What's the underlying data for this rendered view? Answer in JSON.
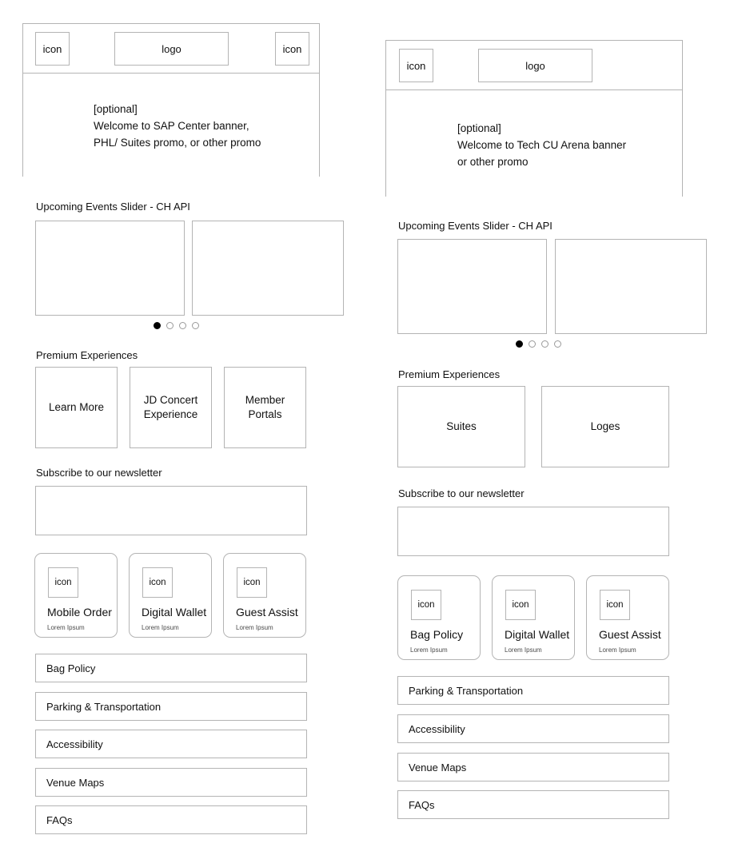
{
  "columns": [
    {
      "id": "sap-center",
      "header": {
        "left_icon": "icon",
        "logo": "logo",
        "right_icon": "icon",
        "banner_text": "[optional]\nWelcome to SAP Center banner,\nPHL/ Suites promo, or other promo"
      },
      "events": {
        "label": "Upcoming Events Slider - CH API",
        "slides": [
          "",
          ""
        ],
        "dots": 4,
        "active_dot": 0
      },
      "premium": {
        "label": "Premium Experiences",
        "tiles": [
          "Learn More",
          "JD Concert\nExperience",
          "Member\nPortals"
        ]
      },
      "newsletter": {
        "label": "Subscribe to our newsletter",
        "field_value": ""
      },
      "features": [
        {
          "icon": "icon",
          "title": "Mobile Order",
          "subtitle": "Lorem Ipsum"
        },
        {
          "icon": "icon",
          "title": "Digital Wallet",
          "subtitle": "Lorem Ipsum"
        },
        {
          "icon": "icon",
          "title": "Guest Assist",
          "subtitle": "Lorem Ipsum"
        }
      ],
      "links": [
        "Bag Policy",
        "Parking & Transportation",
        "Accessibility",
        "Venue Maps",
        "FAQs"
      ]
    },
    {
      "id": "tech-cu-arena",
      "header": {
        "left_icon": "icon",
        "logo": "logo",
        "banner_text": "[optional]\nWelcome to Tech CU Arena banner\nor other promo"
      },
      "events": {
        "label": "Upcoming Events Slider - CH API",
        "slides": [
          "",
          ""
        ],
        "dots": 4,
        "active_dot": 0
      },
      "premium": {
        "label": "Premium Experiences",
        "tiles": [
          "Suites",
          "Loges"
        ]
      },
      "newsletter": {
        "label": "Subscribe to our newsletter",
        "field_value": ""
      },
      "features": [
        {
          "icon": "icon",
          "title": "Bag Policy",
          "subtitle": "Lorem Ipsum"
        },
        {
          "icon": "icon",
          "title": "Digital Wallet",
          "subtitle": "Lorem Ipsum"
        },
        {
          "icon": "icon",
          "title": "Guest Assist",
          "subtitle": "Lorem Ipsum"
        }
      ],
      "links": [
        "Parking & Transportation",
        "Accessibility",
        "Venue Maps",
        "FAQs"
      ]
    }
  ],
  "colors": {
    "border": "#b4b4b4",
    "text": "#111111",
    "muted": "#4a4a4a",
    "dot_active": "#000000",
    "background": "#ffffff"
  }
}
